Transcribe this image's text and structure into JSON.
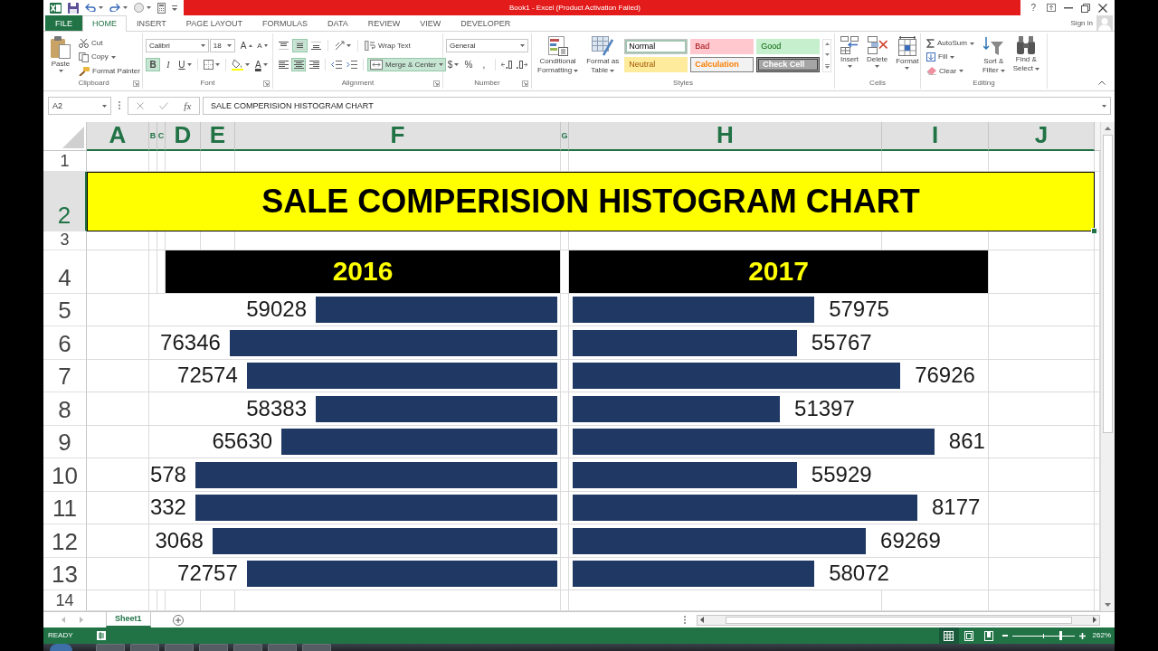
{
  "window": {
    "title": "Book1 - Excel (Product Activation Failed)",
    "help": "?"
  },
  "ribbon_tabs": [
    {
      "label": "FILE",
      "kind": "backstage",
      "selected": false
    },
    {
      "label": "HOME",
      "kind": "tab",
      "selected": true
    },
    {
      "label": "INSERT",
      "kind": "tab",
      "selected": false
    },
    {
      "label": "PAGE LAYOUT",
      "kind": "tab",
      "selected": false
    },
    {
      "label": "FORMULAS",
      "kind": "tab",
      "selected": false
    },
    {
      "label": "DATA",
      "kind": "tab",
      "selected": false
    },
    {
      "label": "REVIEW",
      "kind": "tab",
      "selected": false
    },
    {
      "label": "VIEW",
      "kind": "tab",
      "selected": false
    },
    {
      "label": "DEVELOPER",
      "kind": "tab",
      "selected": false
    }
  ],
  "account": {
    "label": "Sign in"
  },
  "ribbon": {
    "clipboard": {
      "label": "Clipboard",
      "paste": "Paste",
      "cut": "Cut",
      "copy": "Copy",
      "format_painter": "Format Painter"
    },
    "font": {
      "label": "Font",
      "font_name": "Calibri",
      "font_size": "18",
      "grow": "A",
      "shrink": "A",
      "bold": {
        "text": "B",
        "on": true
      },
      "italic": {
        "text": "I",
        "on": false
      },
      "underline": {
        "text": "U",
        "on": false
      },
      "font_color": "A"
    },
    "alignment": {
      "label": "Alignment",
      "vertical": [
        {
          "kind": "top",
          "on": false
        },
        {
          "kind": "middle",
          "on": true
        },
        {
          "kind": "bottom",
          "on": false
        }
      ],
      "horizontal": [
        {
          "kind": "left",
          "on": false
        },
        {
          "kind": "center",
          "on": true
        },
        {
          "kind": "right",
          "on": false
        }
      ],
      "wrap_text": {
        "label": "Wrap Text",
        "on": false
      },
      "merge": {
        "label": "Merge & Center",
        "on": true
      }
    },
    "number": {
      "label": "Number",
      "format": "General",
      "currency": "$",
      "percent": "%",
      "comma": ","
    },
    "styles": {
      "label": "Styles",
      "conditional": [
        "Conditional",
        "Formatting"
      ],
      "table": [
        "Format as",
        "Table"
      ],
      "cell_styles": [
        {
          "label": "Normal",
          "kind": "normal",
          "selected": true
        },
        {
          "label": "Bad",
          "kind": "bad",
          "selected": false
        },
        {
          "label": "Good",
          "kind": "good",
          "selected": false
        },
        {
          "label": "Neutral",
          "kind": "neutral",
          "selected": false
        },
        {
          "label": "Calculation",
          "kind": "calculation",
          "selected": false
        },
        {
          "label": "Check Cell",
          "kind": "check",
          "selected": false
        }
      ]
    },
    "cells": {
      "label": "Cells",
      "buttons": [
        "Insert",
        "Delete",
        "Format"
      ]
    },
    "editing": {
      "label": "Editing",
      "autosum": "AutoSum",
      "fill": "Fill",
      "clear": "Clear",
      "sort": [
        "Sort &",
        "Filter"
      ],
      "find": [
        "Find &",
        "Select"
      ]
    }
  },
  "formula_bar": {
    "name_box": "A2",
    "function": "fx",
    "formula": "SALE COMPERISION HISTOGRAM CHART"
  },
  "sheet": {
    "columns": [
      {
        "label": "A",
        "selected": true
      },
      {
        "label": "B",
        "selected": true
      },
      {
        "label": "C",
        "selected": true
      },
      {
        "label": "D",
        "selected": true
      },
      {
        "label": "E",
        "selected": true
      },
      {
        "label": "F",
        "selected": true
      },
      {
        "label": "G",
        "selected": true
      },
      {
        "label": "H",
        "selected": true
      },
      {
        "label": "I",
        "selected": true
      },
      {
        "label": "J",
        "selected": true
      }
    ],
    "rows": [
      {
        "label": "1",
        "selected": false
      },
      {
        "label": "2",
        "selected": true
      },
      {
        "label": "3",
        "selected": false
      },
      {
        "label": "4",
        "selected": false
      },
      {
        "label": "5",
        "selected": false
      },
      {
        "label": "6",
        "selected": false
      },
      {
        "label": "7",
        "selected": false
      },
      {
        "label": "8",
        "selected": false
      },
      {
        "label": "9",
        "selected": false
      },
      {
        "label": "10",
        "selected": false
      },
      {
        "label": "11",
        "selected": false
      },
      {
        "label": "12",
        "selected": false
      },
      {
        "label": "13",
        "selected": false
      },
      {
        "label": "14",
        "selected": false
      }
    ],
    "title": "SALE COMPERISION HISTOGRAM CHART",
    "series": [
      {
        "heading": "2016",
        "bars": [
          {
            "value": "59028",
            "level": 0.592
          },
          {
            "value": "76346",
            "level": 0.803
          },
          {
            "value": "72574",
            "level": 0.761
          },
          {
            "value": "58383",
            "level": 0.592
          },
          {
            "value": "65630",
            "level": 0.676
          },
          {
            "value": "578",
            "level": 0.887
          },
          {
            "value": "332",
            "level": 0.887
          },
          {
            "value": "3068",
            "level": 0.845
          },
          {
            "value": "72757",
            "level": 0.761
          }
        ]
      },
      {
        "heading": "2017",
        "bars": [
          {
            "value": "57975",
            "level": 0.582
          },
          {
            "value": "55767",
            "level": 0.54
          },
          {
            "value": "76926",
            "level": 0.789
          },
          {
            "value": "51397",
            "level": 0.499
          },
          {
            "value": "861",
            "level": 0.871
          },
          {
            "value": "55929",
            "level": 0.54
          },
          {
            "value": "8177",
            "level": 0.83
          },
          {
            "value": "69269",
            "level": 0.706
          },
          {
            "value": "58072",
            "level": 0.582
          }
        ]
      }
    ]
  },
  "sheet_tabs": [
    {
      "label": "Sheet1",
      "selected": true
    }
  ],
  "status_bar": {
    "mode": "READY",
    "views": [
      {
        "kind": "normal",
        "selected": true
      },
      {
        "kind": "page_layout",
        "selected": false
      },
      {
        "kind": "page_break",
        "selected": false
      }
    ],
    "zoom_slider": {
      "level": 0.77
    },
    "zoom": "262%"
  }
}
